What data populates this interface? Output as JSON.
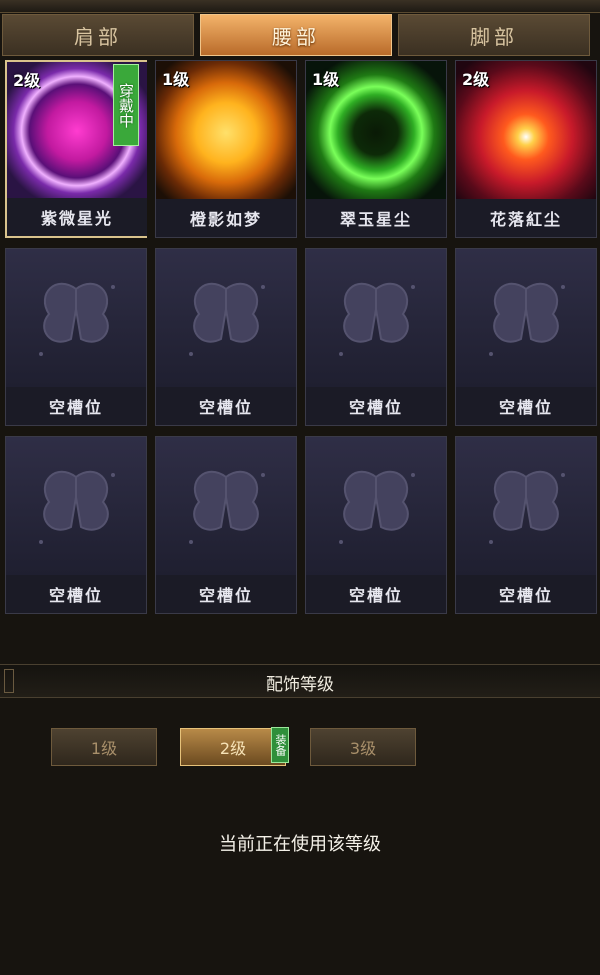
{
  "tabs": [
    {
      "label": "肩部",
      "active": false
    },
    {
      "label": "腰部",
      "active": true
    },
    {
      "label": "脚部",
      "active": false
    }
  ],
  "items": [
    {
      "name": "紫微星光",
      "level": "2级",
      "wearing": "穿戴中",
      "color": "#d23cff"
    },
    {
      "name": "橙影如梦",
      "level": "1级",
      "color": "#ffb21e"
    },
    {
      "name": "翠玉星尘",
      "level": "1级",
      "color": "#3ad62a"
    },
    {
      "name": "花落紅尘",
      "level": "2级",
      "color": "#ff5a1e"
    }
  ],
  "empty_slot_label": "空槽位",
  "level_panel": {
    "title": "配饰等级",
    "buttons": [
      "1级",
      "2级",
      "3级"
    ],
    "equip_badge": "装备",
    "status": "当前正在使用该等级"
  }
}
